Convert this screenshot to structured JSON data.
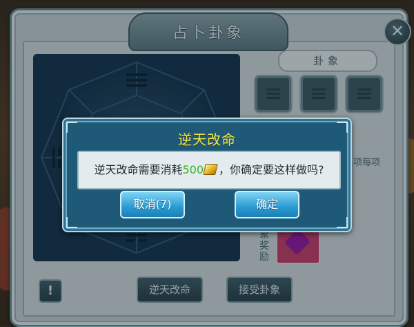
{
  "window": {
    "title": "占卜卦象"
  },
  "panel": {
    "hexagram_header": "卦象",
    "side_label": "象奖励",
    "partial_right_text": "项每项",
    "buttons": {
      "change_fate": "逆天改命",
      "accept_hexagram": "接受卦象",
      "info": "!"
    }
  },
  "dialog": {
    "title": "逆天改命",
    "message_prefix": "逆天改命需要消耗",
    "cost": "500",
    "currency_icon": "gold-ingot-icon",
    "message_suffix": "，你确定要这样做吗?",
    "cancel_label": "取消(7)",
    "confirm_label": "确定"
  },
  "colors": {
    "dialog_title": "#f4e44b",
    "cost_text": "#39b226",
    "button_blue": "#2a9bd3"
  }
}
